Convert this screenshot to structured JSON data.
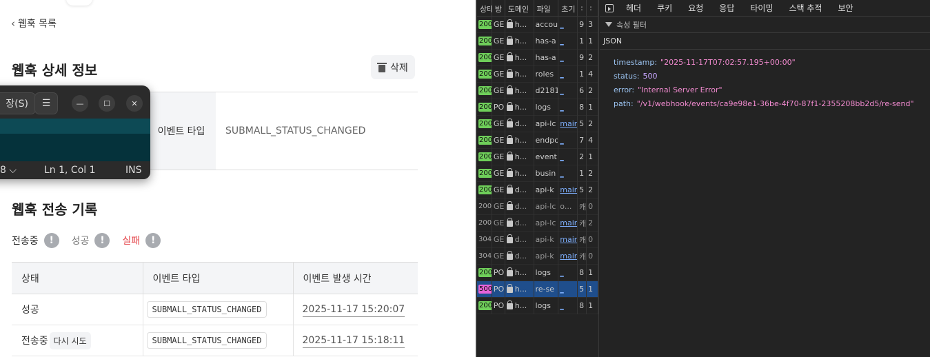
{
  "page": {
    "back_link": "웹훅 목록",
    "detail_title": "웹훅 상세 정보",
    "delete_label": "삭제",
    "event_type_label": "이벤트 타입",
    "event_type_value": "SUBMALL_STATUS_CHANGED",
    "history_title": "웹훅 전송 기록",
    "legend": {
      "sending": "전송중",
      "success": "성공",
      "fail": "실패"
    },
    "table": {
      "headers": [
        "상태",
        "이벤트 타입",
        "이벤트 발생 시간"
      ],
      "rows": [
        {
          "status": "성공",
          "event_type": "SUBMALL_STATUS_CHANGED",
          "time": "2025-11-17 15:20:07"
        },
        {
          "status": "전송중",
          "retry": "다시 시도",
          "event_type": "SUBMALL_STATUS_CHANGED",
          "time": "2025-11-17 15:18:11"
        }
      ]
    }
  },
  "editor": {
    "save_label": "장(S)",
    "menu_icon": "☰",
    "encoding": "8",
    "position": "Ln 1, Col 1",
    "mode": "INS"
  },
  "devtools": {
    "list_headers": [
      "상태",
      "방",
      "도메인",
      "파일",
      "초기",
      ":",
      ":"
    ],
    "rows": [
      {
        "status": "200",
        "method": "GE",
        "domain": "h...",
        "file": "accou",
        "init": "_",
        "a": "9",
        "b": "3"
      },
      {
        "status": "200",
        "method": "GE",
        "domain": "h...",
        "file": "has-a",
        "init": "_",
        "a": "1",
        "b": "1"
      },
      {
        "status": "200",
        "method": "GE",
        "domain": "h...",
        "file": "has-a",
        "init": "_",
        "a": "9",
        "b": "2"
      },
      {
        "status": "200",
        "method": "GE",
        "domain": "h...",
        "file": "roles",
        "init": "_",
        "a": "1",
        "b": "4"
      },
      {
        "status": "200",
        "method": "GE",
        "domain": "h...",
        "file": "d2181",
        "init": "_",
        "a": "6",
        "b": "2"
      },
      {
        "status": "200",
        "method": "PO",
        "domain": "h...",
        "file": "logs",
        "init": "_",
        "a": "8",
        "b": "1"
      },
      {
        "status": "200",
        "method": "GE",
        "domain": "d...",
        "file": "api-lc",
        "init": "mair",
        "a": "5",
        "b": "2"
      },
      {
        "status": "200",
        "method": "GE",
        "domain": "h...",
        "file": "endpo",
        "init": "_",
        "a": "7",
        "b": "4"
      },
      {
        "status": "200",
        "method": "GE",
        "domain": "h...",
        "file": "event",
        "init": "_",
        "a": "2",
        "b": "1"
      },
      {
        "status": "200",
        "method": "GE",
        "domain": "h...",
        "file": "busin",
        "init": "_",
        "a": "1",
        "b": "2"
      },
      {
        "status": "200",
        "method": "GE",
        "domain": "d...",
        "file": "api-k",
        "init": "mair",
        "a": "5",
        "b": "2"
      },
      {
        "status": "200",
        "method": "GE",
        "domain": "d...",
        "file": "api-lc",
        "init": "o...",
        "a": "캐",
        "b": "0"
      },
      {
        "status": "200",
        "method": "GE",
        "domain": "d...",
        "file": "api-lc",
        "init": "mair",
        "a": "캐",
        "b": "2"
      },
      {
        "status": "304",
        "method": "GE",
        "domain": "d...",
        "file": "api-k",
        "init": "mair",
        "a": "캐",
        "b": "0"
      },
      {
        "status": "304",
        "method": "GE",
        "domain": "d...",
        "file": "api-k",
        "init": "mair",
        "a": "캐",
        "b": "0"
      },
      {
        "status": "200",
        "method": "PO",
        "domain": "h...",
        "file": "logs",
        "init": "_",
        "a": "8",
        "b": "1"
      },
      {
        "status": "500",
        "method": "PO",
        "domain": "h...",
        "file": "re-se",
        "init": "_",
        "a": "5",
        "b": "1"
      },
      {
        "status": "200",
        "method": "PO",
        "domain": "h...",
        "file": "logs",
        "init": "_",
        "a": "8",
        "b": "1"
      }
    ],
    "tabs": [
      "헤더",
      "쿠키",
      "요청",
      "응답",
      "타이밍",
      "스택 추적",
      "보안"
    ],
    "active_tab": "응답",
    "filter_placeholder": "속성 필터",
    "json_label": "JSON",
    "response": {
      "timestamp": "\"2025-11-17T07:02:57.195+00:00\"",
      "status": "500",
      "error": "\"Internal Server Error\"",
      "path": "\"/v1/webhook/events/ca9e98e1-36be-4f70-87f1-2355208bb2d5/re-send\""
    }
  }
}
